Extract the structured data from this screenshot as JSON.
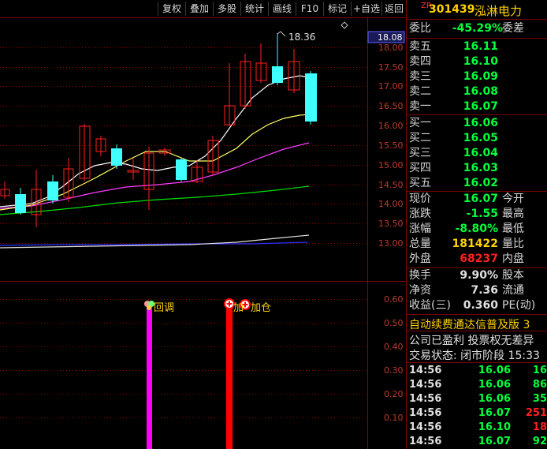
{
  "toolbar": {
    "buttons": [
      "复权",
      "叠加",
      "多股",
      "统计",
      "画线",
      "F10",
      "标记",
      "+自选",
      "返回"
    ]
  },
  "chart": {
    "price_axis": [
      "18.00",
      "17.50",
      "17.00",
      "16.50",
      "16.00",
      "15.50",
      "15.00",
      "14.50",
      "14.00",
      "13.50",
      "13.00"
    ],
    "current_price_tag": "18.08",
    "high_marker": "18.36",
    "indicator_axis": [
      "0.60",
      "0.50",
      "0.40",
      "0.30",
      "0.20",
      "0.10"
    ],
    "signal_1_label": "回调",
    "signal_2_label": "加仓",
    "signal_2_prefix": "加"
  },
  "stock": {
    "badge": "ZR",
    "code": "301439",
    "name": "泓淋电力"
  },
  "order_book": {
    "ratio_label": "委比",
    "ratio_value": "-45.29%",
    "diff_label": "委差",
    "sells": [
      {
        "label": "卖五",
        "price": "16.11"
      },
      {
        "label": "卖四",
        "price": "16.10"
      },
      {
        "label": "卖三",
        "price": "16.09"
      },
      {
        "label": "卖二",
        "price": "16.08"
      },
      {
        "label": "卖一",
        "price": "16.07"
      }
    ],
    "buys": [
      {
        "label": "买一",
        "price": "16.06"
      },
      {
        "label": "买二",
        "price": "16.05"
      },
      {
        "label": "买三",
        "price": "16.04"
      },
      {
        "label": "买四",
        "price": "16.03"
      },
      {
        "label": "买五",
        "price": "16.02"
      }
    ]
  },
  "quote": {
    "now_label": "现价",
    "now_value": "16.07",
    "open_label": "今开",
    "chg_label": "涨跌",
    "chg_value": "-1.55",
    "high_label": "最高",
    "pct_label": "涨幅",
    "pct_value": "-8.80%",
    "low_label": "最低",
    "vol_label": "总量",
    "vol_value": "181422",
    "vr_label": "量比",
    "outer_label": "外盘",
    "outer_value": "68237",
    "inner_label": "内盘"
  },
  "fundamentals": {
    "turnover_label": "换手",
    "turnover_value": "9.90%",
    "equity_label": "股本",
    "nav_label": "净资",
    "nav_value": "7.36",
    "float_label": "流通",
    "eps_label": "收益(三)",
    "eps_value": "0.360",
    "pe_label": "PE(动)"
  },
  "ticker": {
    "line1": "自动续费通达信普及版 3",
    "line2": "公司已盈利 投票权无差异",
    "line3": "交易状态: 闭市阶段 15:33"
  },
  "ticks": [
    {
      "time": "14:56",
      "price": "16.06",
      "vol": "16",
      "color": "#00ff3c"
    },
    {
      "time": "14:56",
      "price": "16.06",
      "vol": "86",
      "color": "#00ff3c"
    },
    {
      "time": "14:56",
      "price": "16.06",
      "vol": "35",
      "color": "#00ff3c"
    },
    {
      "time": "14:56",
      "price": "16.07",
      "vol": "251",
      "color": "#ff2020"
    },
    {
      "time": "14:56",
      "price": "16.10",
      "vol": "18",
      "color": "#ff2020"
    },
    {
      "time": "14:56",
      "price": "16.07",
      "vol": "92",
      "color": "#00ff3c"
    }
  ],
  "colors": {
    "up": "#ff2020",
    "down": "#40ffff",
    "ma5": "#ffffff",
    "ma10": "#ffff64",
    "ma20": "#ff3cff",
    "ma60": "#00e000",
    "ma120": "#e0e0e0",
    "ma250": "#3030ff",
    "signal_1": "#ff00ff",
    "signal_2": "#ff0000"
  }
}
